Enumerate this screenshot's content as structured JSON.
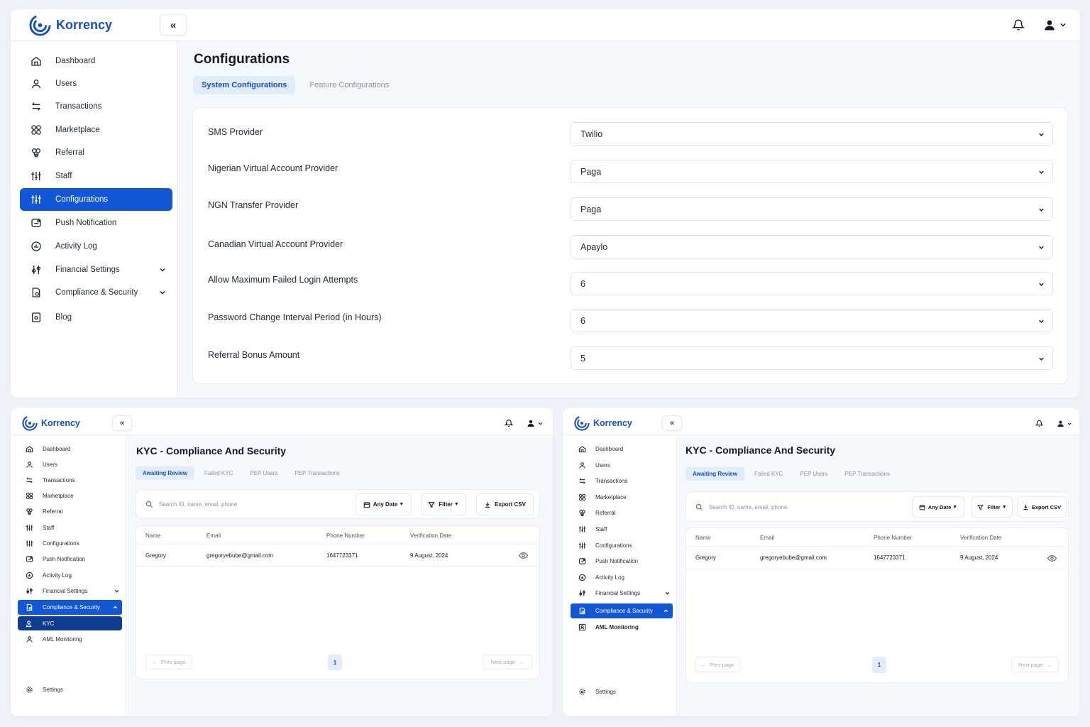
{
  "brand": {
    "name": "Korrency",
    "accent": "#1257d6",
    "accent_dark": "#0e3d8f"
  },
  "top": {
    "sidebar": [
      {
        "label": "Dashboard",
        "icon": "home-icon"
      },
      {
        "label": "Users",
        "icon": "user-icon"
      },
      {
        "label": "Transactions",
        "icon": "transfer-icon"
      },
      {
        "label": "Marketplace",
        "icon": "marketplace-icon"
      },
      {
        "label": "Referral",
        "icon": "referral-icon"
      },
      {
        "label": "Staff",
        "icon": "sliders-icon"
      },
      {
        "label": "Configurations",
        "icon": "sliders-icon"
      },
      {
        "label": "Push Notification",
        "icon": "notification-icon"
      },
      {
        "label": "Activity Log",
        "icon": "activity-icon"
      },
      {
        "label": "Financial Settings",
        "icon": "finance-icon"
      },
      {
        "label": "Compliance & Security",
        "icon": "shield-doc-icon"
      },
      {
        "label": "Blog",
        "icon": "blog-icon"
      }
    ],
    "page_title": "Configurations",
    "tabs": [
      "System Configurations",
      "Feature Configurations"
    ],
    "configs": [
      {
        "label": "SMS Provider",
        "value": "Twilio"
      },
      {
        "label": "Nigerian Virtual Account Provider",
        "value": "Paga"
      },
      {
        "label": "NGN Transfer Provider",
        "value": "Paga"
      },
      {
        "label": "Canadian Virtual Account Provider",
        "value": "Apaylo"
      },
      {
        "label": "Allow Maximum Failed Login Attempts",
        "value": "6"
      },
      {
        "label": "Password Change Interval Period (in Hours)",
        "value": "6"
      },
      {
        "label": "Referral Bonus Amount",
        "value": "5"
      }
    ]
  },
  "kyc": {
    "page_title": "KYC - Compliance And Security",
    "tabs": [
      "Awaiting Review",
      "Failed KYC",
      "PEP Users",
      "PEP Transactions"
    ],
    "search_placeholder": "Search ID, name, email, phone",
    "any_date": "Any Date",
    "filter": "Filter",
    "export": "Export CSV",
    "columns": [
      "Name",
      "Email",
      "Phone Number",
      "Verification Date"
    ],
    "rows": [
      {
        "name": "Gregory",
        "email": "gregoryebube@gmail.com",
        "phone": "1647723371",
        "date": "9 August, 2024"
      }
    ],
    "prev": "Prev page",
    "next": "Next page",
    "page": "1",
    "settings": "Settings"
  },
  "left": {
    "sidebar": [
      {
        "label": "Dashboard",
        "icon": "home-icon"
      },
      {
        "label": "Users",
        "icon": "user-icon"
      },
      {
        "label": "Transactions",
        "icon": "transfer-icon"
      },
      {
        "label": "Marketplace",
        "icon": "marketplace-icon"
      },
      {
        "label": "Referral",
        "icon": "referral-icon"
      },
      {
        "label": "Staff",
        "icon": "sliders-icon"
      },
      {
        "label": "Configurations",
        "icon": "sliders-icon"
      },
      {
        "label": "Push Notification",
        "icon": "notification-icon"
      },
      {
        "label": "Activity Log",
        "icon": "activity-icon"
      },
      {
        "label": "Financial Settings",
        "icon": "finance-icon"
      },
      {
        "label": "Compliance & Security",
        "icon": "shield-doc-icon"
      },
      {
        "label": "KYC",
        "icon": "user-check-icon"
      },
      {
        "label": "AML Monitoring",
        "icon": "user-icon"
      }
    ]
  },
  "right": {
    "sidebar": [
      {
        "label": "Dashboard",
        "icon": "home-icon"
      },
      {
        "label": "Users",
        "icon": "user-icon"
      },
      {
        "label": "Transactions",
        "icon": "transfer-icon"
      },
      {
        "label": "Marketplace",
        "icon": "marketplace-icon"
      },
      {
        "label": "Referral",
        "icon": "referral-icon"
      },
      {
        "label": "Staff",
        "icon": "sliders-icon"
      },
      {
        "label": "Configurations",
        "icon": "sliders-icon"
      },
      {
        "label": "Push Notification",
        "icon": "notification-icon"
      },
      {
        "label": "Activity Log",
        "icon": "activity-icon"
      },
      {
        "label": "Financial Settings",
        "icon": "finance-icon"
      },
      {
        "label": "Compliance & Security",
        "icon": "shield-doc-icon"
      },
      {
        "label": "AML Monitoring",
        "icon": "user-box-icon"
      }
    ]
  }
}
